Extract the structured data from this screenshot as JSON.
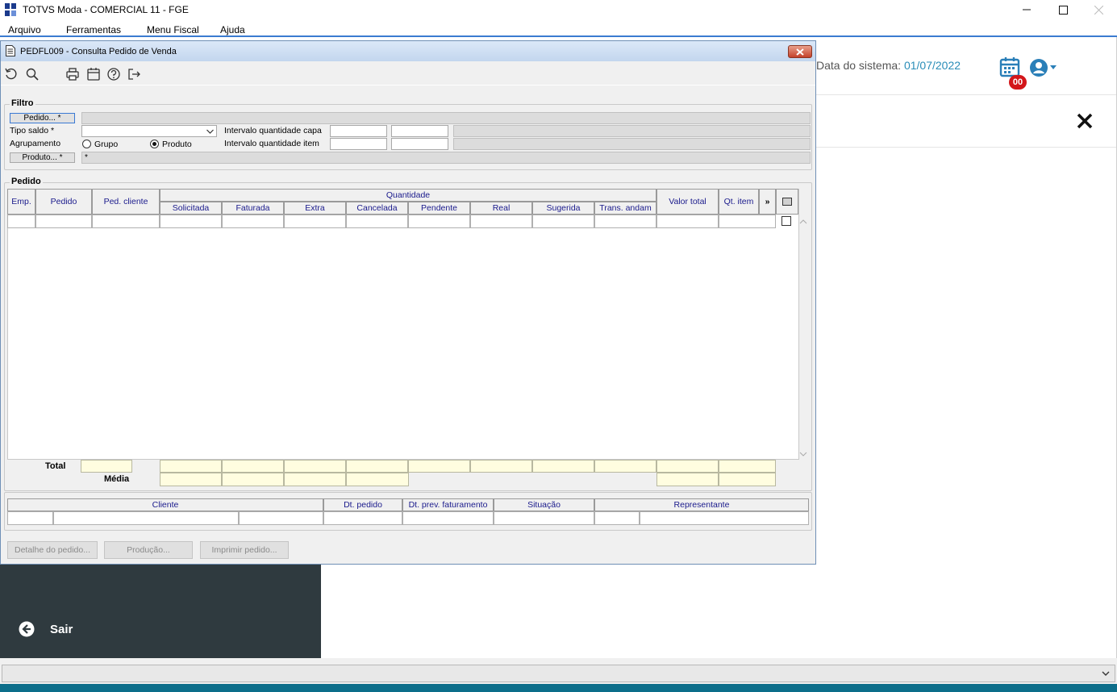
{
  "app": {
    "title": "TOTVS Moda - COMERCIAL 11 - FGE",
    "menu": [
      "Arquivo",
      "Ferramentas",
      "Menu Fiscal",
      "Ajuda"
    ]
  },
  "background": {
    "sysdate_label": "Data do sistema:",
    "sysdate_value": "01/07/2022",
    "calendar_badge": "00",
    "sair_label": "Sair"
  },
  "dialog": {
    "title": "PEDFL009 - Consulta Pedido de Venda",
    "filtro": {
      "title": "Filtro",
      "pedido_button": "Pedido... *",
      "tipo_saldo_label": "Tipo saldo *",
      "agrupamento_label": "Agrupamento",
      "radio_grupo": "Grupo",
      "radio_produto": "Produto",
      "produto_button": "Produto... *",
      "produto_value": "*",
      "intervalo_capa_label": "Intervalo quantidade capa",
      "intervalo_item_label": "Intervalo quantidade item"
    },
    "pedido": {
      "title": "Pedido",
      "headers": {
        "emp": "Emp.",
        "pedido": "Pedido",
        "ped_cliente": "Ped. cliente",
        "quantidade": "Quantidade",
        "solicitada": "Solicitada",
        "faturada": "Faturada",
        "extra": "Extra",
        "cancelada": "Cancelada",
        "pendente": "Pendente",
        "real": "Real",
        "sugerida": "Sugerida",
        "trans_andam": "Trans. andam",
        "valor_total": "Valor total",
        "qt_item": "Qt. item",
        "more": "»"
      },
      "total_label": "Total",
      "media_label": "Média"
    },
    "info_headers": {
      "cliente": "Cliente",
      "dt_pedido": "Dt. pedido",
      "dt_prev": "Dt. prev. faturamento",
      "situacao": "Situação",
      "representante": "Representante"
    },
    "buttons": {
      "detalhe": "Detalhe do pedido...",
      "producao": "Produção...",
      "imprimir": "Imprimir pedido..."
    }
  }
}
